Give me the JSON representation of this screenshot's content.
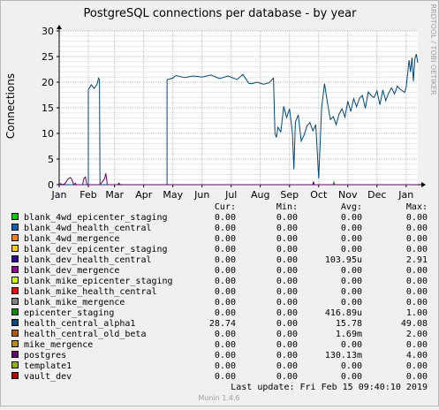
{
  "chart_data": {
    "type": "line",
    "title": "PostgreSQL connections per database - by year",
    "ylabel": "Connections",
    "xlabel": "",
    "side_label": "RRDTOOL / TOBI OETIKER",
    "ylim": [
      0,
      30
    ],
    "y_ticks": [
      0,
      5,
      10,
      15,
      20,
      25,
      30
    ],
    "x_range": [
      0,
      12.3
    ],
    "x_ticks": [
      {
        "label": "Jan",
        "x": 0
      },
      {
        "label": "Feb",
        "x": 1
      },
      {
        "label": "Mar",
        "x": 1.9
      },
      {
        "label": "Apr",
        "x": 2.9
      },
      {
        "label": "May",
        "x": 3.9
      },
      {
        "label": "Jun",
        "x": 4.9
      },
      {
        "label": "Jul",
        "x": 5.9
      },
      {
        "label": "Aug",
        "x": 6.9
      },
      {
        "label": "Sep",
        "x": 7.9
      },
      {
        "label": "Oct",
        "x": 8.9
      },
      {
        "label": "Nov",
        "x": 9.9
      },
      {
        "label": "Dec",
        "x": 10.9
      },
      {
        "label": "Jan",
        "x": 11.9
      }
    ],
    "grid": true,
    "legend_headers": {
      "cur": "Cur:",
      "min": "Min:",
      "avg": "Avg:",
      "max": "Max:"
    },
    "series": [
      {
        "name": "blank_4wd_epicenter_staging",
        "color": "#00cc00",
        "cur": "0.00",
        "min": "0.00",
        "avg": "0.00",
        "max": "0.00",
        "points": []
      },
      {
        "name": "blank_4wd_health_central",
        "color": "#0066b3",
        "cur": "0.00",
        "min": "0.00",
        "avg": "0.00",
        "max": "0.00",
        "points": []
      },
      {
        "name": "blank_4wd_mergence",
        "color": "#ff8000",
        "cur": "0.00",
        "min": "0.00",
        "avg": "0.00",
        "max": "0.00",
        "points": []
      },
      {
        "name": "blank_dev_epicenter_staging",
        "color": "#ffcc00",
        "cur": "0.00",
        "min": "0.00",
        "avg": "0.00",
        "max": "0.00",
        "points": []
      },
      {
        "name": "blank_dev_health_central",
        "color": "#330099",
        "cur": "0.00",
        "min": "0.00",
        "avg": "103.95u",
        "max": "2.91",
        "points": [
          [
            8.7,
            0
          ],
          [
            8.72,
            0.6
          ],
          [
            8.75,
            0
          ]
        ]
      },
      {
        "name": "blank_dev_mergence",
        "color": "#990099",
        "cur": "0.00",
        "min": "0.00",
        "avg": "0.00",
        "max": "0.00",
        "points": []
      },
      {
        "name": "blank_mike_epicenter_staging",
        "color": "#ccff00",
        "cur": "0.00",
        "min": "0.00",
        "avg": "0.00",
        "max": "0.00",
        "points": []
      },
      {
        "name": "blank_mike_health_central",
        "color": "#ff0000",
        "cur": "0.00",
        "min": "0.00",
        "avg": "0.00",
        "max": "0.00",
        "points": []
      },
      {
        "name": "blank_mike_mergence",
        "color": "#808080",
        "cur": "0.00",
        "min": "0.00",
        "avg": "0.00",
        "max": "0.00",
        "points": []
      },
      {
        "name": "epicenter_staging",
        "color": "#008f00",
        "cur": "0.00",
        "min": "0.00",
        "avg": "416.89u",
        "max": "1.00",
        "points": [
          [
            9.4,
            0
          ],
          [
            9.42,
            0.5
          ],
          [
            9.45,
            0
          ]
        ]
      },
      {
        "name": "health_central_alpha1",
        "color": "#00487d",
        "cur": "28.74",
        "min": "0.00",
        "avg": "15.78",
        "max": "49.08",
        "points": [
          [
            0,
            0
          ],
          [
            1.0,
            0
          ],
          [
            1.0,
            18.5
          ],
          [
            1.1,
            19.5
          ],
          [
            1.2,
            18.8
          ],
          [
            1.3,
            19.6
          ],
          [
            1.35,
            20.8
          ],
          [
            1.38,
            20.5
          ],
          [
            1.4,
            0
          ],
          [
            3.7,
            0
          ],
          [
            3.7,
            20.5
          ],
          [
            3.9,
            20.8
          ],
          [
            4.0,
            21.3
          ],
          [
            4.3,
            20.9
          ],
          [
            4.6,
            21.2
          ],
          [
            4.9,
            21.0
          ],
          [
            5.2,
            21.4
          ],
          [
            5.5,
            20.7
          ],
          [
            5.8,
            21.2
          ],
          [
            6.1,
            20.5
          ],
          [
            6.3,
            21.5
          ],
          [
            6.5,
            19.8
          ],
          [
            6.6,
            19.7
          ],
          [
            6.8,
            20.0
          ],
          [
            7.0,
            19.6
          ],
          [
            7.2,
            19.9
          ],
          [
            7.35,
            20.8
          ],
          [
            7.4,
            10.0
          ],
          [
            7.45,
            9.2
          ],
          [
            7.5,
            11.2
          ],
          [
            7.6,
            10.3
          ],
          [
            7.7,
            15.3
          ],
          [
            7.8,
            13.1
          ],
          [
            7.9,
            14.8
          ],
          [
            8.0,
            10.0
          ],
          [
            8.05,
            3.0
          ],
          [
            8.1,
            12.2
          ],
          [
            8.2,
            13.6
          ],
          [
            8.3,
            8.5
          ],
          [
            8.4,
            9.7
          ],
          [
            8.5,
            11.5
          ],
          [
            8.6,
            12.1
          ],
          [
            8.7,
            10.5
          ],
          [
            8.8,
            11.7
          ],
          [
            8.9,
            1.2
          ],
          [
            9.0,
            15.0
          ],
          [
            9.1,
            19.7
          ],
          [
            9.2,
            16.0
          ],
          [
            9.3,
            12.7
          ],
          [
            9.4,
            13.3
          ],
          [
            9.5,
            11.7
          ],
          [
            9.6,
            13.8
          ],
          [
            9.7,
            14.8
          ],
          [
            9.8,
            13.2
          ],
          [
            9.9,
            16.3
          ],
          [
            10.0,
            14.3
          ],
          [
            10.1,
            16.8
          ],
          [
            10.2,
            15.2
          ],
          [
            10.3,
            16.9
          ],
          [
            10.4,
            17.4
          ],
          [
            10.5,
            14.9
          ],
          [
            10.6,
            18.1
          ],
          [
            10.7,
            17.4
          ],
          [
            10.8,
            17.0
          ],
          [
            10.9,
            18.3
          ],
          [
            11.0,
            15.6
          ],
          [
            11.1,
            18.5
          ],
          [
            11.2,
            16.4
          ],
          [
            11.3,
            17.9
          ],
          [
            11.4,
            18.9
          ],
          [
            11.5,
            17.7
          ],
          [
            11.6,
            19.2
          ],
          [
            11.7,
            18.6
          ],
          [
            11.8,
            18.2
          ],
          [
            11.85,
            18.0
          ],
          [
            11.9,
            19.0
          ],
          [
            12.0,
            24.3
          ],
          [
            12.05,
            22.0
          ],
          [
            12.1,
            24.8
          ],
          [
            12.15,
            20.2
          ],
          [
            12.2,
            24.5
          ],
          [
            12.25,
            25.5
          ],
          [
            12.3,
            23.8
          ]
        ]
      },
      {
        "name": "health_central_old_beta",
        "color": "#b35a00",
        "cur": "0.00",
        "min": "0.00",
        "avg": "1.69m",
        "max": "2.00",
        "points": []
      },
      {
        "name": "mike_mergence",
        "color": "#b38f00",
        "cur": "0.00",
        "min": "0.00",
        "avg": "0.00",
        "max": "0.00",
        "points": []
      },
      {
        "name": "postgres",
        "color": "#6b006b",
        "cur": "0.00",
        "min": "0.00",
        "avg": "130.13m",
        "max": "4.00",
        "points": [
          [
            0,
            0
          ],
          [
            0.05,
            0.2
          ],
          [
            0.1,
            0
          ],
          [
            0.2,
            0.2
          ],
          [
            0.3,
            1.1
          ],
          [
            0.38,
            1.4
          ],
          [
            0.42,
            1.2
          ],
          [
            0.5,
            0
          ],
          [
            0.55,
            0.3
          ],
          [
            0.6,
            0
          ],
          [
            0.8,
            0
          ],
          [
            0.85,
            1.2
          ],
          [
            0.9,
            1.5
          ],
          [
            0.95,
            0
          ],
          [
            1.4,
            0
          ],
          [
            1.55,
            1.1
          ],
          [
            1.6,
            2.2
          ],
          [
            1.65,
            0
          ],
          [
            2.0,
            0
          ],
          [
            2.05,
            0.3
          ],
          [
            2.1,
            0
          ],
          [
            12.3,
            0
          ]
        ]
      },
      {
        "name": "template1",
        "color": "#8fb300",
        "cur": "0.00",
        "min": "0.00",
        "avg": "0.00",
        "max": "0.00",
        "points": []
      },
      {
        "name": "vault_dev",
        "color": "#b30000",
        "cur": "0.00",
        "min": "0.00",
        "avg": "0.00",
        "max": "0.00",
        "points": []
      }
    ],
    "last_update": "Last update:  Fri Feb 15 09:40:10 2019",
    "footer": "Munin 1.4.6"
  }
}
